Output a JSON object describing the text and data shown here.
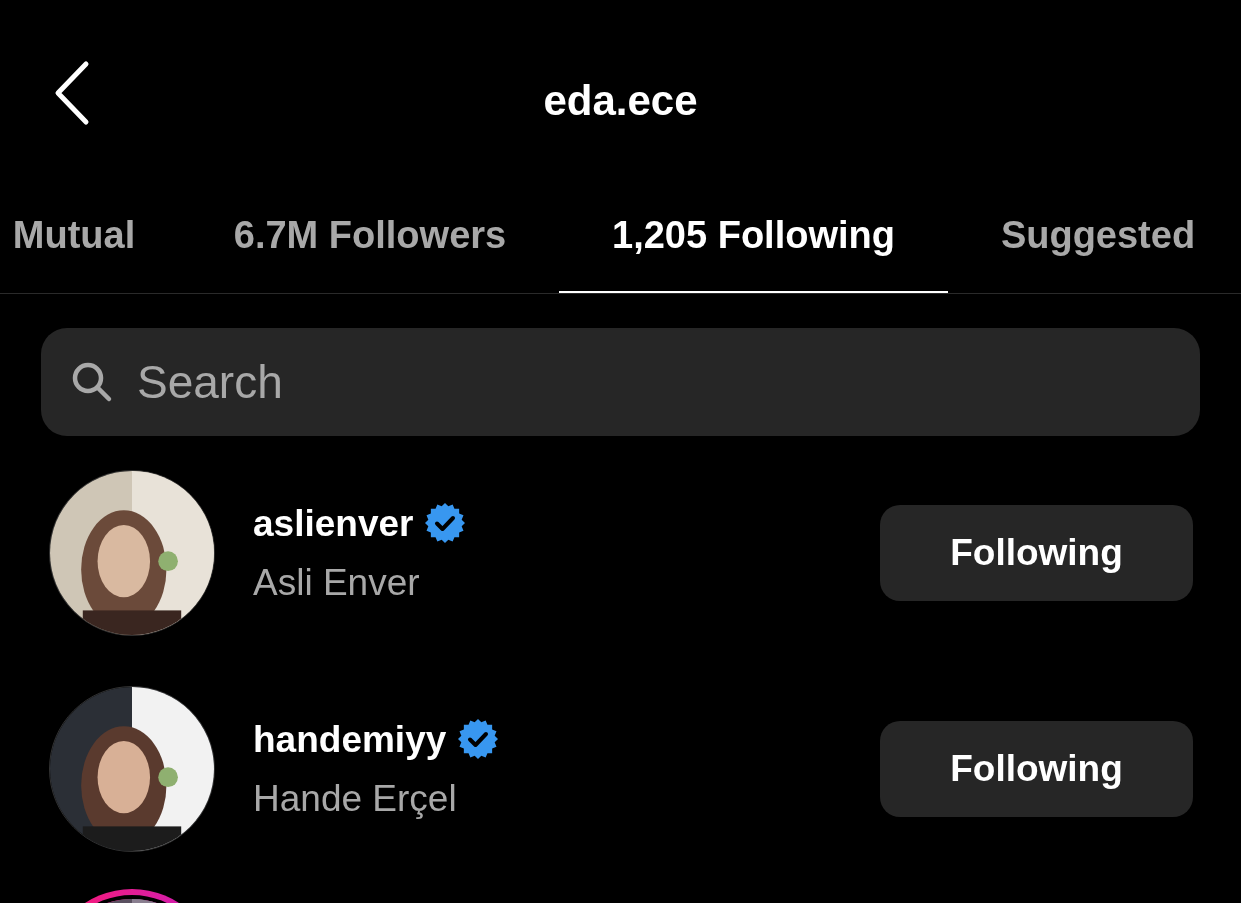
{
  "header": {
    "title": "eda.ece"
  },
  "tabs": [
    {
      "label": "Mutual",
      "selected": false
    },
    {
      "label": "6.7M Followers",
      "selected": false
    },
    {
      "label": "1,205 Following",
      "selected": true
    },
    {
      "label": "Suggested",
      "selected": false
    }
  ],
  "search": {
    "placeholder": "Search"
  },
  "accounts": [
    {
      "username": "aslienver",
      "name": "Asli Enver",
      "verified": true,
      "button": "Following",
      "story_ring": false
    },
    {
      "username": "handemiyy",
      "name": "Hande Erçel",
      "verified": true,
      "button": "Following",
      "story_ring": false
    },
    {
      "story_ring": true
    }
  ]
}
